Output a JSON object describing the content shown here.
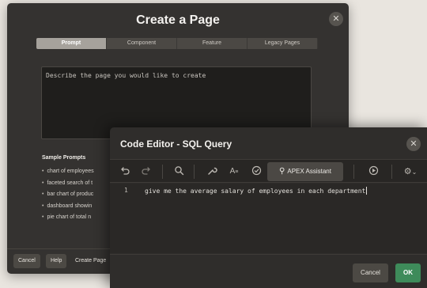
{
  "create_page_dialog": {
    "title": "Create a Page",
    "close_icon": "close-icon",
    "tabs": [
      {
        "label": "Prompt",
        "active": true
      },
      {
        "label": "Component",
        "active": false
      },
      {
        "label": "Feature",
        "active": false
      },
      {
        "label": "Legacy Pages",
        "active": false
      }
    ],
    "prompt_placeholder": "Describe the page you would like to create",
    "sample_prompts_heading": "Sample Prompts",
    "sample_prompts": [
      "chart of employees",
      "faceted search of t",
      "bar chart of produc",
      "dashboard showin",
      "pie chart of total n"
    ],
    "footer": {
      "cancel_label": "Cancel",
      "help_label": "Help",
      "create_page_label": "Create Page"
    }
  },
  "code_editor_dialog": {
    "title": "Code Editor - SQL Query",
    "close_icon": "close-icon",
    "toolbar": {
      "undo_icon": "undo-icon",
      "redo_icon": "redo-icon",
      "search_icon": "search-icon",
      "wrench_icon": "wrench-icon",
      "format_icon": "format-icon",
      "validate_icon": "check-circle-icon",
      "apex_assistant_label": "APEX Assistant",
      "run_icon": "play-icon",
      "settings_icon": "gear-icon"
    },
    "editor": {
      "lines": [
        {
          "number": "1",
          "text": "give me the average salary of employees in each department"
        }
      ]
    },
    "footer": {
      "cancel_label": "Cancel",
      "ok_label": "OK"
    }
  },
  "colors": {
    "dialog_background": "#343230",
    "editor_background": "#2a2826",
    "ok_button": "#3e8b5a",
    "page_background": "#e9e5df"
  }
}
